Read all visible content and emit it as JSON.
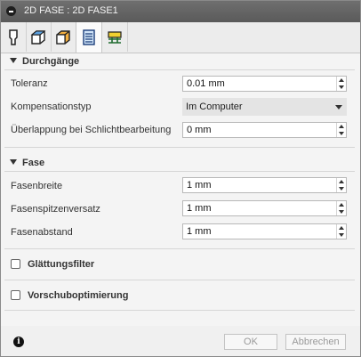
{
  "window": {
    "title": "2D FASE : 2D FASE1"
  },
  "tabs": [
    {
      "name": "tool-tab-icon"
    },
    {
      "name": "geometry-tab-icon"
    },
    {
      "name": "heights-tab-icon"
    },
    {
      "name": "passes-tab-icon"
    },
    {
      "name": "linking-tab-icon"
    }
  ],
  "sections": {
    "durchgaenge": {
      "title": "Durchgänge",
      "toleranz_label": "Toleranz",
      "toleranz_value": "0.01 mm",
      "kompensation_label": "Kompensationstyp",
      "kompensation_value": "Im Computer",
      "ueberlappung_label": "Überlappung bei Schlichtbearbeitung",
      "ueberlappung_value": "0 mm"
    },
    "fase": {
      "title": "Fase",
      "breite_label": "Fasenbreite",
      "breite_value": "1 mm",
      "spitzen_label": "Fasenspitzenversatz",
      "spitzen_value": "1 mm",
      "abstand_label": "Fasenabstand",
      "abstand_value": "1 mm"
    },
    "glaettung": {
      "label": "Glättungsfilter",
      "checked": false
    },
    "vorschub": {
      "label": "Vorschuboptimierung",
      "checked": false
    }
  },
  "footer": {
    "ok_label": "OK",
    "cancel_label": "Abbrechen"
  }
}
